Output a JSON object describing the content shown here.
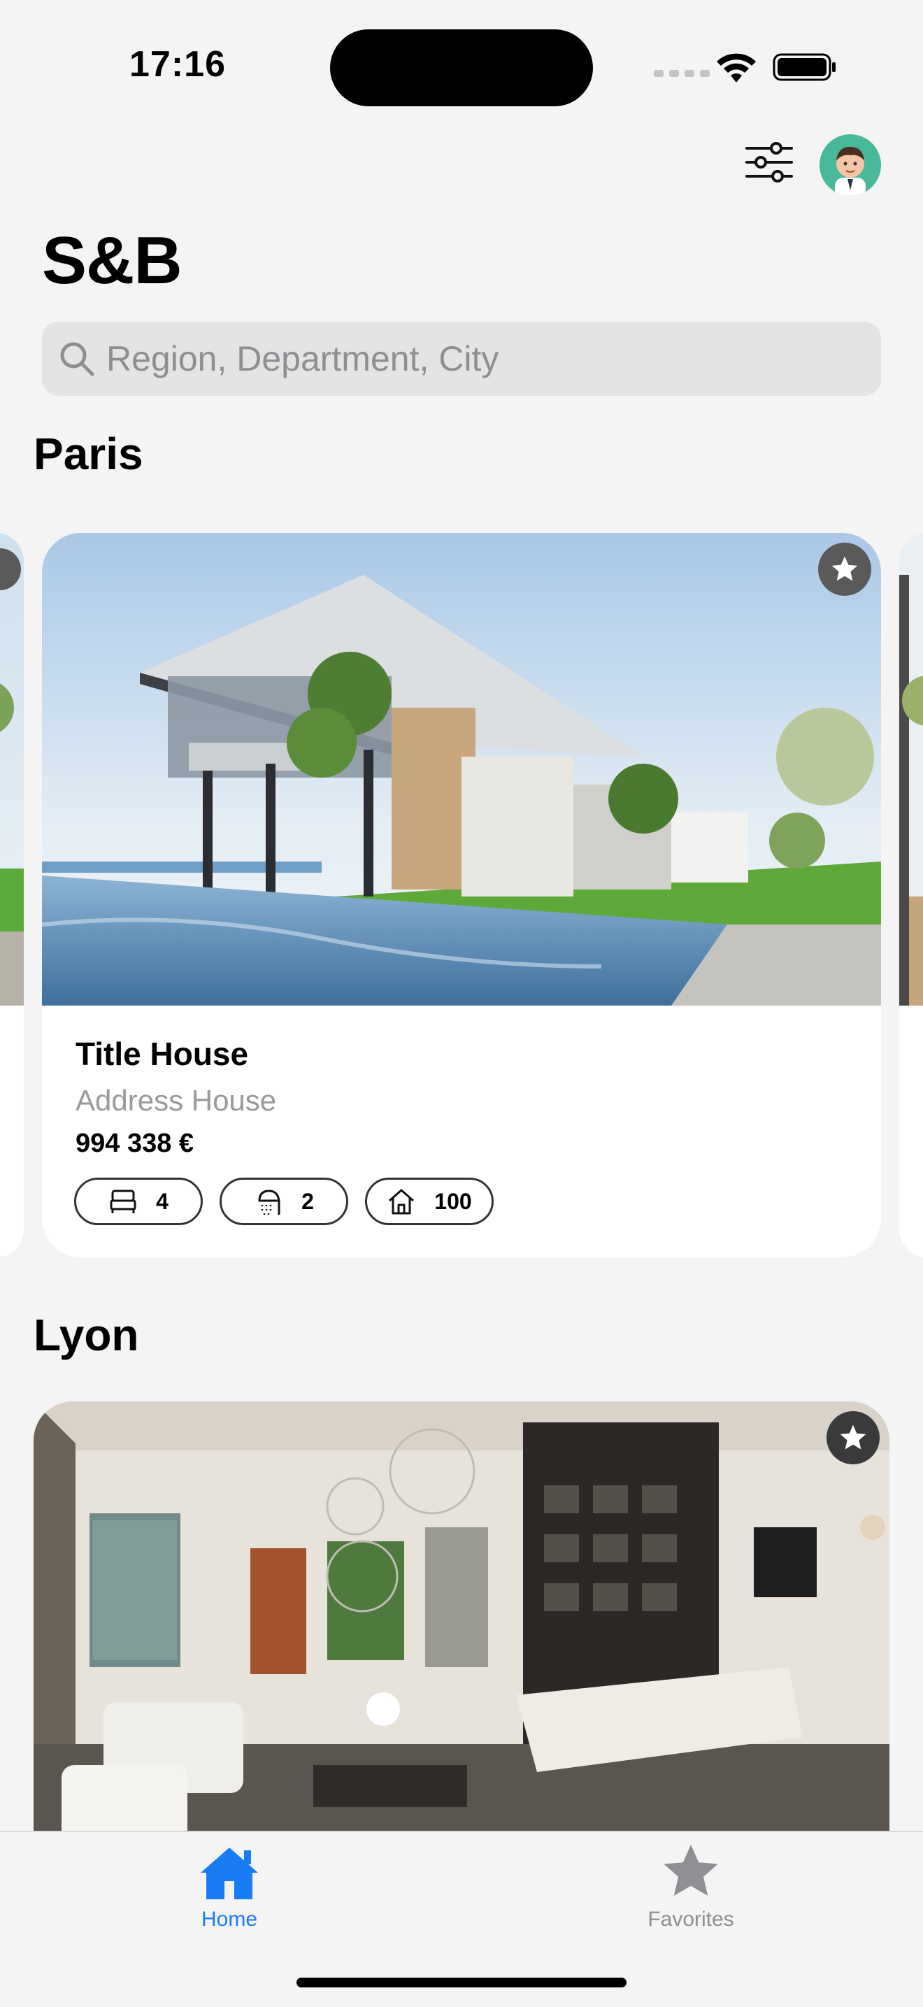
{
  "status_bar": {
    "time": "17:16"
  },
  "header": {
    "title": "S&B"
  },
  "search": {
    "placeholder": "Region, Department, City"
  },
  "sections": [
    {
      "title": "Paris",
      "card": {
        "title": "Title House",
        "address": "Address House",
        "price": "994 338 €",
        "bedrooms": "4",
        "bathrooms": "2",
        "area": "100"
      }
    },
    {
      "title": "Lyon"
    }
  ],
  "tabbar": {
    "home_label": "Home",
    "favorites_label": "Favorites"
  },
  "colors": {
    "accent": "#1a7cf5",
    "inactive": "#8e8e93",
    "background": "#f4f4f4"
  },
  "icons": [
    "wifi-icon",
    "battery-icon",
    "filter-icon",
    "avatar",
    "search-icon",
    "star-icon",
    "bed-icon",
    "shower-icon",
    "house-icon",
    "home-icon"
  ]
}
